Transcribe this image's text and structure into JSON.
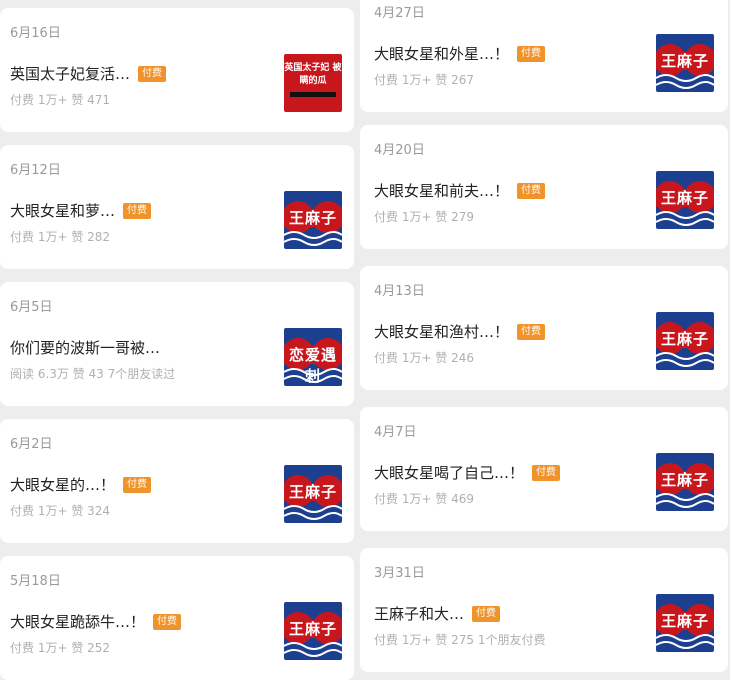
{
  "badge_label": "付费",
  "left": [
    {
      "date": "6月16日",
      "title": "英国太子妃复活…",
      "meta": "付费 1万+  赞 471",
      "thumb": {
        "style": "red",
        "text": "英国太子妃 被瞒的瓜"
      }
    },
    {
      "date": "6月12日",
      "title": "大眼女星和萝…",
      "meta": "付费 1万+  赞 282",
      "thumb": {
        "style": "blue",
        "text": "王麻子"
      }
    },
    {
      "date": "6月5日",
      "title": "你们要的波斯一哥被…",
      "meta": "阅读 6.3万  赞 43  7个朋友读过",
      "thumb": {
        "style": "blue",
        "text": "恋爱遇刺"
      }
    },
    {
      "date": "6月2日",
      "title": "大眼女星的…！",
      "meta": "付费 1万+  赞 324",
      "thumb": {
        "style": "blue",
        "text": "王麻子"
      }
    },
    {
      "date": "5月18日",
      "title": "大眼女星跪舔牛…！",
      "meta": "付费 1万+  赞 252",
      "thumb": {
        "style": "blue",
        "text": "王麻子"
      }
    }
  ],
  "right": [
    {
      "date": "4月27日",
      "title": "大眼女星和外星…！",
      "meta": "付费 1万+  赞 267",
      "thumb": {
        "style": "blue",
        "text": "王麻子"
      }
    },
    {
      "date": "4月20日",
      "title": "大眼女星和前夫…！",
      "meta": "付费 1万+  赞 279",
      "thumb": {
        "style": "blue",
        "text": "王麻子"
      }
    },
    {
      "date": "4月13日",
      "title": "大眼女星和渔村…！",
      "meta": "付费 1万+  赞 246",
      "thumb": {
        "style": "blue",
        "text": "王麻子"
      }
    },
    {
      "date": "4月7日",
      "title": "大眼女星喝了自己…！",
      "meta": "付费 1万+  赞 469",
      "thumb": {
        "style": "blue",
        "text": "王麻子"
      }
    },
    {
      "date": "3月31日",
      "title": "王麻子和大…",
      "meta": "付费 1万+  赞 275  1个朋友付费",
      "thumb": {
        "style": "blue",
        "text": "王麻子"
      }
    }
  ],
  "colors": {
    "badge": "#f0932b",
    "thumb_red": "#c8161d",
    "thumb_blue": "#1d3f8f"
  }
}
